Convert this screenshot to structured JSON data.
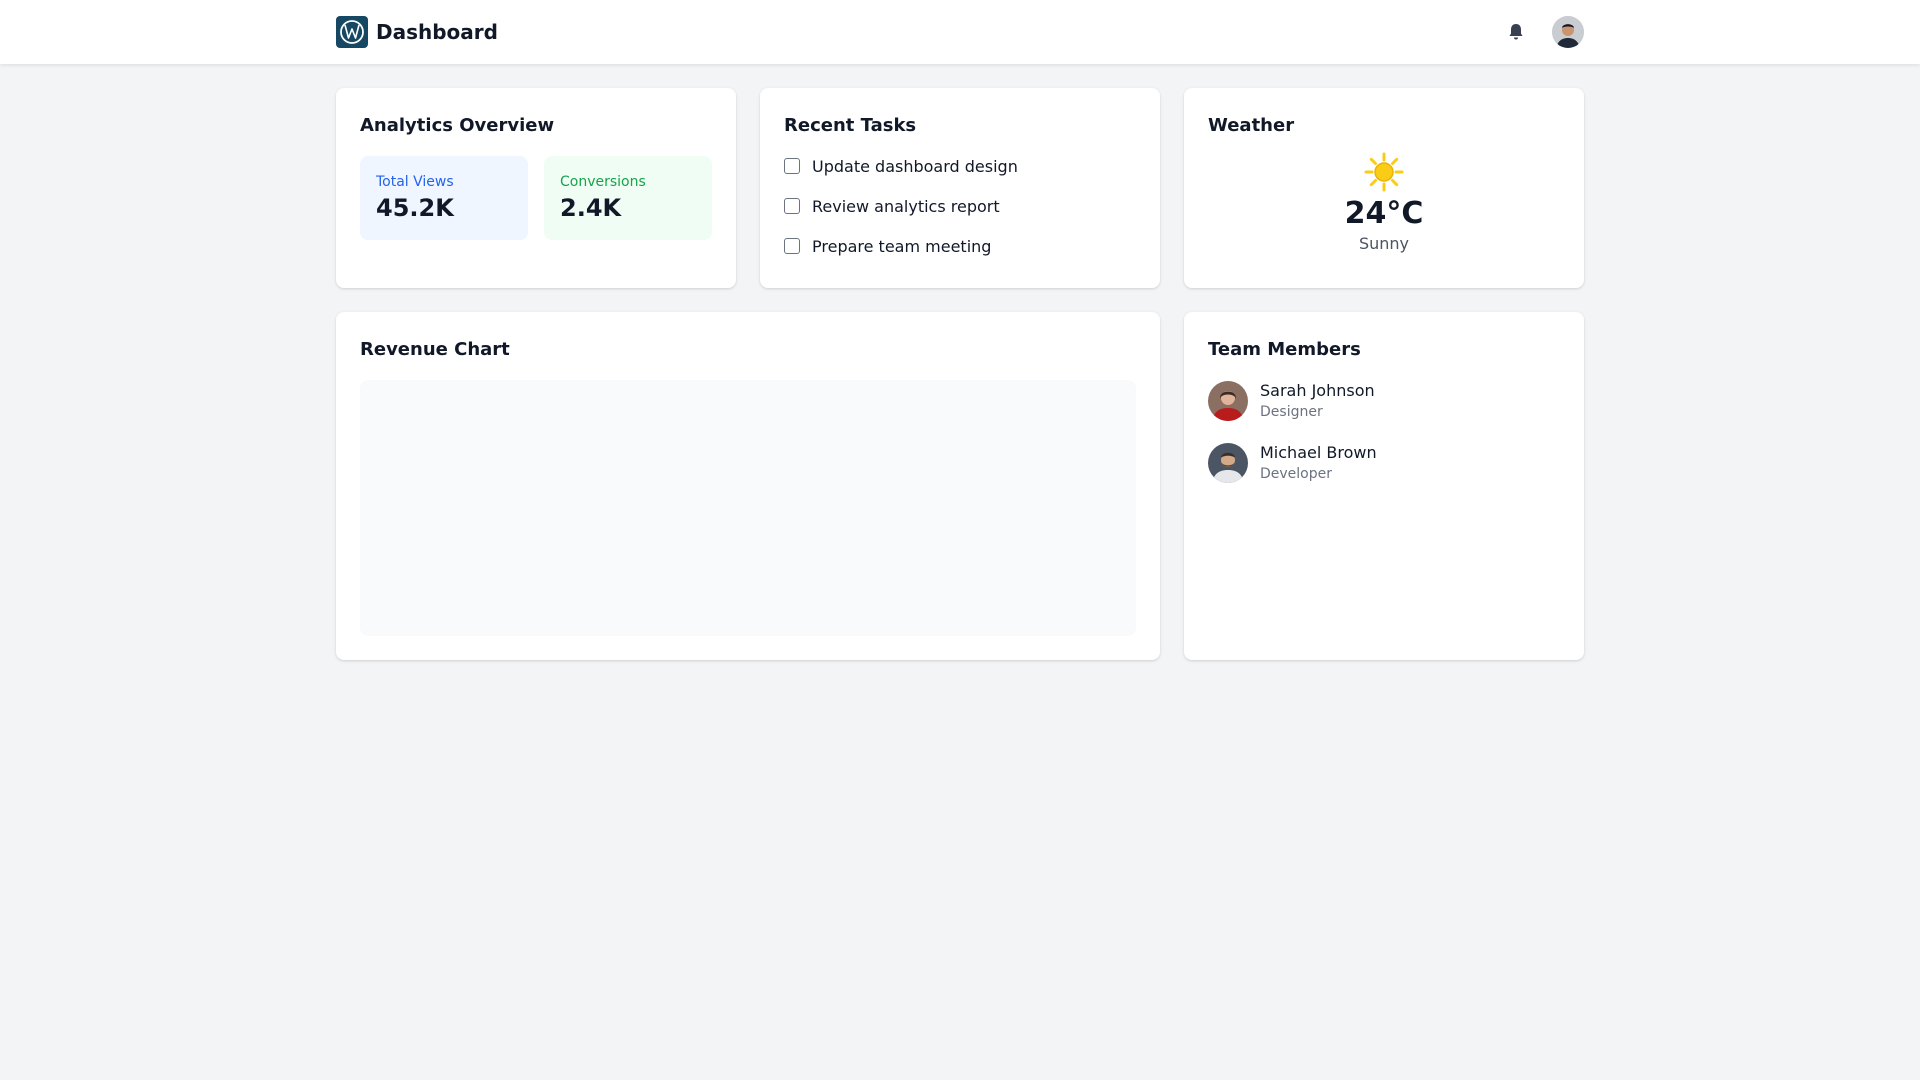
{
  "header": {
    "title": "Dashboard",
    "logo_icon": "vw-logo-icon",
    "notification_icon": "bell-icon",
    "avatar": "user-avatar"
  },
  "analytics": {
    "title": "Analytics Overview",
    "stats": [
      {
        "label": "Total Views",
        "value": "45.2K",
        "color": "#2563eb"
      },
      {
        "label": "Conversions",
        "value": "2.4K",
        "color": "#16a34a"
      }
    ]
  },
  "tasks": {
    "title": "Recent Tasks",
    "items": [
      {
        "label": "Update dashboard design",
        "checked": false
      },
      {
        "label": "Review analytics report",
        "checked": false
      },
      {
        "label": "Prepare team meeting",
        "checked": false
      }
    ]
  },
  "weather": {
    "title": "Weather",
    "icon": "sun-icon",
    "temperature": "24°C",
    "condition": "Sunny"
  },
  "revenue": {
    "title": "Revenue Chart"
  },
  "team": {
    "title": "Team Members",
    "members": [
      {
        "name": "Sarah Johnson",
        "role": "Designer"
      },
      {
        "name": "Michael Brown",
        "role": "Developer"
      }
    ]
  },
  "colors": {
    "accent_blue": "#2563eb",
    "accent_green": "#16a34a",
    "logo_bg": "#164863",
    "sun": "#facc15"
  }
}
